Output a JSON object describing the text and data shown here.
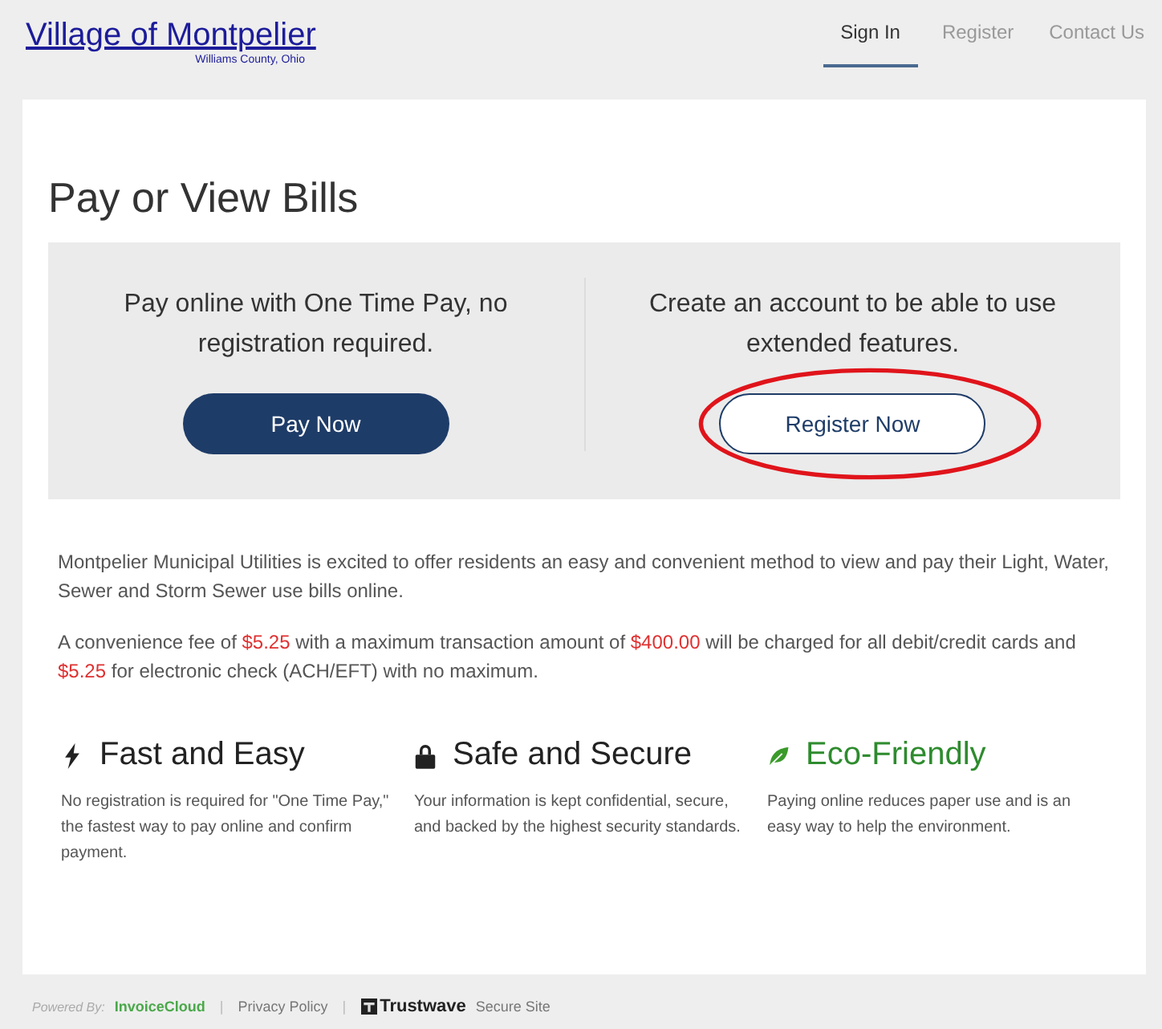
{
  "header": {
    "logo": "Village of Montpelier",
    "tagline": "Williams County, Ohio",
    "nav": [
      {
        "label": "Sign In",
        "selected": true
      },
      {
        "label": "Register",
        "selected": false
      },
      {
        "label": "Contact Us",
        "selected": false
      }
    ]
  },
  "title": "Pay or View Bills",
  "options": [
    {
      "text": "Pay online with One Time Pay, no registration required.",
      "button": "Pay Now",
      "kind": "primary",
      "circled": false
    },
    {
      "text": "Create an account to be able to use extended features.",
      "button": "Register Now",
      "kind": "outline",
      "circled": true
    }
  ],
  "paragraphs": [
    [
      {
        "text": "Montpelier Municipal Utilities is excited to offer residents an easy and convenient method to view and pay their Light, Water, Sewer and Storm Sewer use bills online.",
        "highlight": false
      }
    ],
    [
      {
        "text": "A convenience fee of ",
        "highlight": false
      },
      {
        "text": "$5.25",
        "highlight": true
      },
      {
        "text": " with a maximum transaction amount of ",
        "highlight": false
      },
      {
        "text": "$400.00",
        "highlight": true
      },
      {
        "text": " will be charged for all debit/credit cards and ",
        "highlight": false
      },
      {
        "text": "$5.25",
        "highlight": true
      },
      {
        "text": " for electronic check (ACH/EFT) with no maximum.",
        "highlight": false
      }
    ]
  ],
  "features": [
    {
      "kind": "bolt",
      "title": "Fast and Easy",
      "text": "No registration is required for \"One Time Pay,\" the fastest way to pay online and confirm payment."
    },
    {
      "kind": "lock",
      "title": "Safe and Secure",
      "text": "Your information is kept confidential, secure, and backed by the highest security standards."
    },
    {
      "kind": "leaf",
      "title": "Eco-Friendly",
      "text": "Paying online reduces paper use and is an easy way to help the environment."
    }
  ],
  "footer": {
    "powered_by": "Powered By:",
    "provider": "InvoiceCloud",
    "separator_1": "|",
    "privacy": "Privacy Policy",
    "separator_2": "|",
    "trust_brand": "Trustwave",
    "trust_text": "Secure Site"
  }
}
